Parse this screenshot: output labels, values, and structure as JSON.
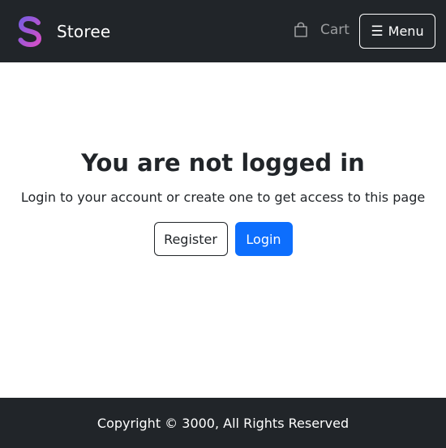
{
  "navbar": {
    "brand_name": "Storee",
    "logo_icon": "s-logo-icon",
    "cart_label": "Cart",
    "cart_icon": "shopping-bag-icon",
    "menu_icon": "hamburger-icon",
    "menu_label": "Menu"
  },
  "main": {
    "heading": "You are not logged in",
    "subtext": "Login to your account or create one to get access to this page",
    "register_label": "Register",
    "login_label": "Login"
  },
  "footer": {
    "copyright": "Copyright © 3000, All Rights Reserved"
  },
  "colors": {
    "navbar_bg": "#212529",
    "primary": "#0d6efd",
    "logo_gradient_start": "#8e5bd9",
    "logo_gradient_end": "#d64fc8"
  }
}
